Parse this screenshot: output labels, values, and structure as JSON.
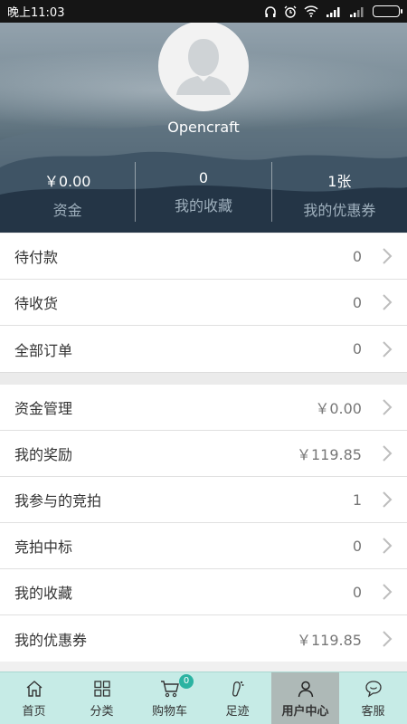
{
  "status_bar": {
    "time": "晚上11:03"
  },
  "header": {
    "username": "Opencraft",
    "stats": [
      {
        "value": "￥0.00",
        "label": "资金"
      },
      {
        "value": "0",
        "label": "我的收藏"
      },
      {
        "value": "1张",
        "label": "我的优惠券"
      }
    ]
  },
  "orders": [
    {
      "label": "待付款",
      "value": "0"
    },
    {
      "label": "待收货",
      "value": "0"
    },
    {
      "label": "全部订单",
      "value": "0"
    }
  ],
  "account": [
    {
      "label": "资金管理",
      "value": "￥0.00"
    },
    {
      "label": "我的奖励",
      "value": "￥119.85"
    },
    {
      "label": "我参与的竞拍",
      "value": "1"
    },
    {
      "label": "竞拍中标",
      "value": "0"
    },
    {
      "label": "我的收藏",
      "value": "0"
    },
    {
      "label": "我的优惠券",
      "value": "￥119.85"
    }
  ],
  "tabs": [
    {
      "label": "首页",
      "icon": "home-icon"
    },
    {
      "label": "分类",
      "icon": "grid-icon"
    },
    {
      "label": "购物车",
      "icon": "cart-icon",
      "badge": "0"
    },
    {
      "label": "足迹",
      "icon": "footprint-icon"
    },
    {
      "label": "用户中心",
      "icon": "user-icon",
      "active": true
    },
    {
      "label": "客服",
      "icon": "chat-icon"
    }
  ],
  "colors": {
    "tab_bar": "#c6ebe6",
    "tab_active": "#aeb9b7",
    "badge": "#2bb3a2"
  }
}
